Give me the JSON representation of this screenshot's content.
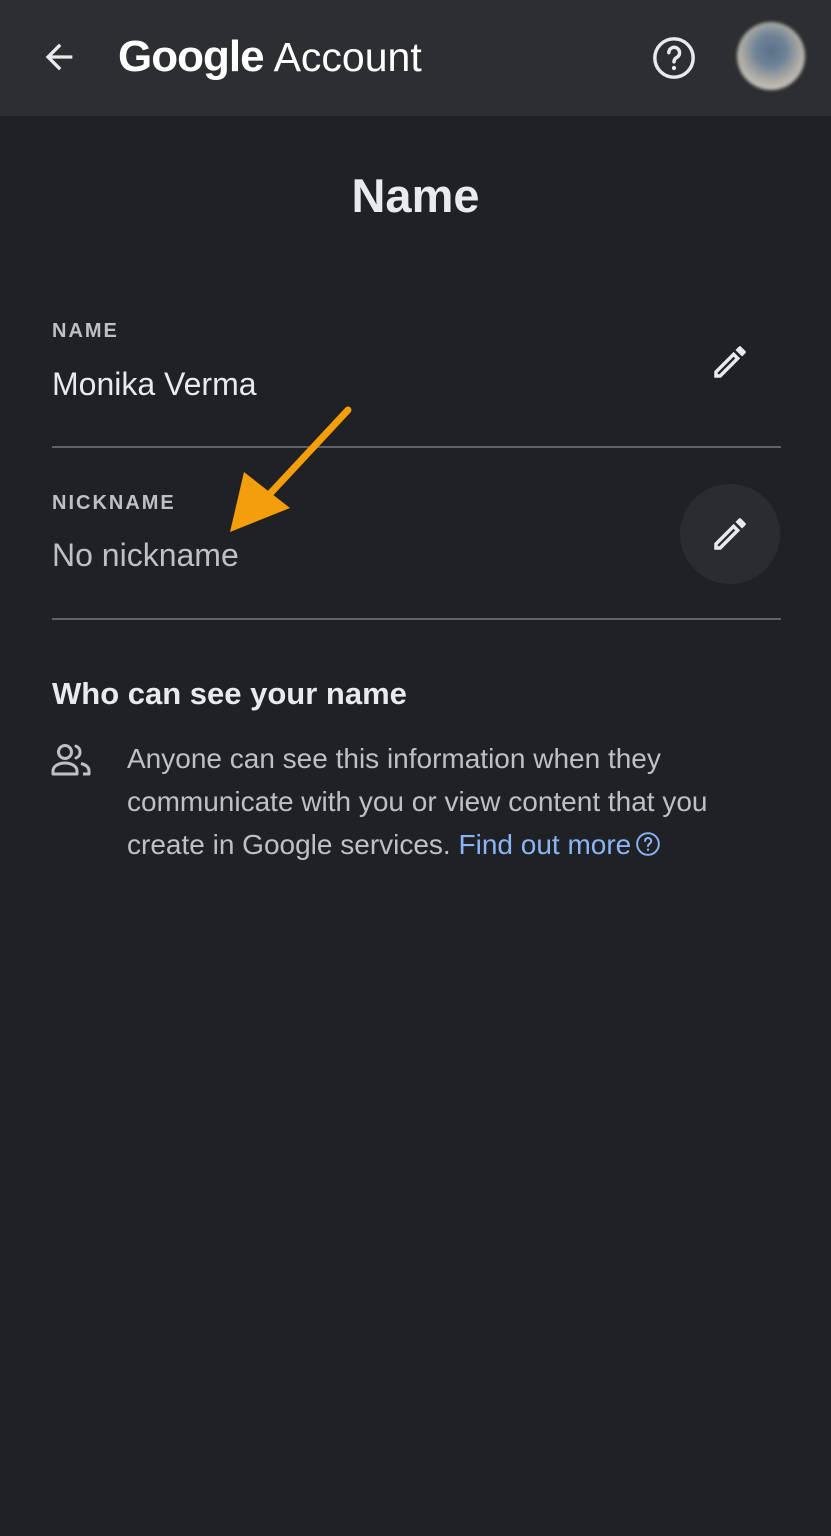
{
  "app_bar": {
    "brand_google": "Google",
    "brand_account": "Account"
  },
  "page": {
    "title": "Name"
  },
  "fields": [
    {
      "label": "NAME",
      "value": "Monika Verma"
    },
    {
      "label": "NICKNAME",
      "value": "No nickname"
    }
  ],
  "visibility": {
    "heading": "Who can see your name",
    "text": "Anyone can see this information when they communicate with you or view content that you create in Google services. ",
    "link": "Find out more"
  },
  "icons": [
    "back-arrow-icon",
    "help-icon",
    "edit-icon",
    "people-icon",
    "help-circle-icon",
    "annotation-arrow"
  ],
  "colors": {
    "background": "#202124",
    "app_bar": "#2d2e31",
    "link": "#8ab4f8",
    "annotation_arrow": "#f59e0b"
  }
}
